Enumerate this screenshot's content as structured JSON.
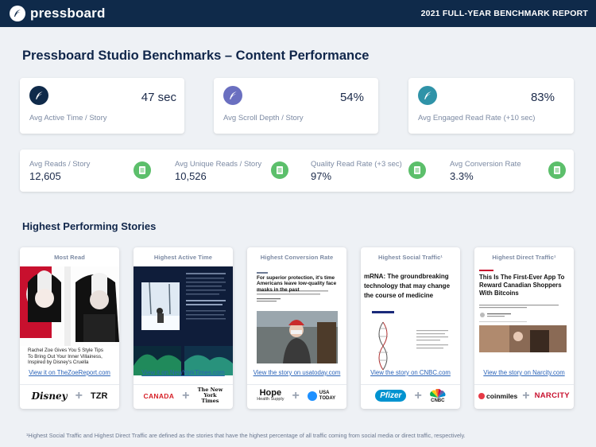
{
  "header": {
    "brand": "pressboard",
    "report_title": "2021 FULL-YEAR BENCHMARK REPORT"
  },
  "page_title": "Pressboard Studio Benchmarks – Content Performance",
  "stats": [
    {
      "value": "47 sec",
      "label": "Avg Active Time / Story",
      "color": "#0f2a4a"
    },
    {
      "value": "54%",
      "label": "Avg Scroll Depth / Story",
      "color": "#6a6fc0"
    },
    {
      "value": "83%",
      "label": "Avg Engaged Read Rate (+10 sec)",
      "color": "#2f93a8"
    }
  ],
  "metrics": [
    {
      "label": "Avg Reads / Story",
      "value": "12,605"
    },
    {
      "label": "Avg Unique Reads / Story",
      "value": "10,526"
    },
    {
      "label": "Quality Read Rate (+3 sec)",
      "value": "97%"
    },
    {
      "label": "Avg Conversion Rate",
      "value": "3.3%"
    }
  ],
  "section_title": "Highest Performing Stories",
  "stories": [
    {
      "heading": "Most Read",
      "link": "View it on TheZoeReport.com",
      "logo_left": "Disney",
      "logo_right": "TZR",
      "caption": "Rachel Zoe Gives You 5 Style Tips To Bring Out Your Inner Villainess, Inspired by Disney's Cruella"
    },
    {
      "heading": "Highest Active Time",
      "link": "View it on NewYorkTimes.com",
      "logo_left": "CANADA",
      "logo_right": "The New York Times"
    },
    {
      "heading": "Highest Conversion Rate",
      "link": "View the story on usatoday.com",
      "logo_left": "Hope",
      "logo_left_sub": "Health Supply",
      "logo_right": "USA TODAY",
      "article_title": "For superior protection, it's time Americans leave low-quality face masks in the past"
    },
    {
      "heading": "Highest Social Traffic¹",
      "link": "View the story on CNBC.com",
      "logo_left": "Pfizer",
      "logo_right": "CNBC",
      "article_title": "mRNA: The groundbreaking technology that may change the course of medicine"
    },
    {
      "heading": "Highest Direct Traffic¹",
      "link": "View the story on Narcity.com",
      "logo_left": "coinmiles",
      "logo_right": "NARCITY",
      "article_title": "This Is The First-Ever App To Reward Canadian Shoppers With Bitcoins"
    }
  ],
  "footnote": "¹Highest Social Traffic and Highest Direct Traffic are defined as the stories that have the highest percentage of all traffic coming from social media or direct traffic, respectively."
}
